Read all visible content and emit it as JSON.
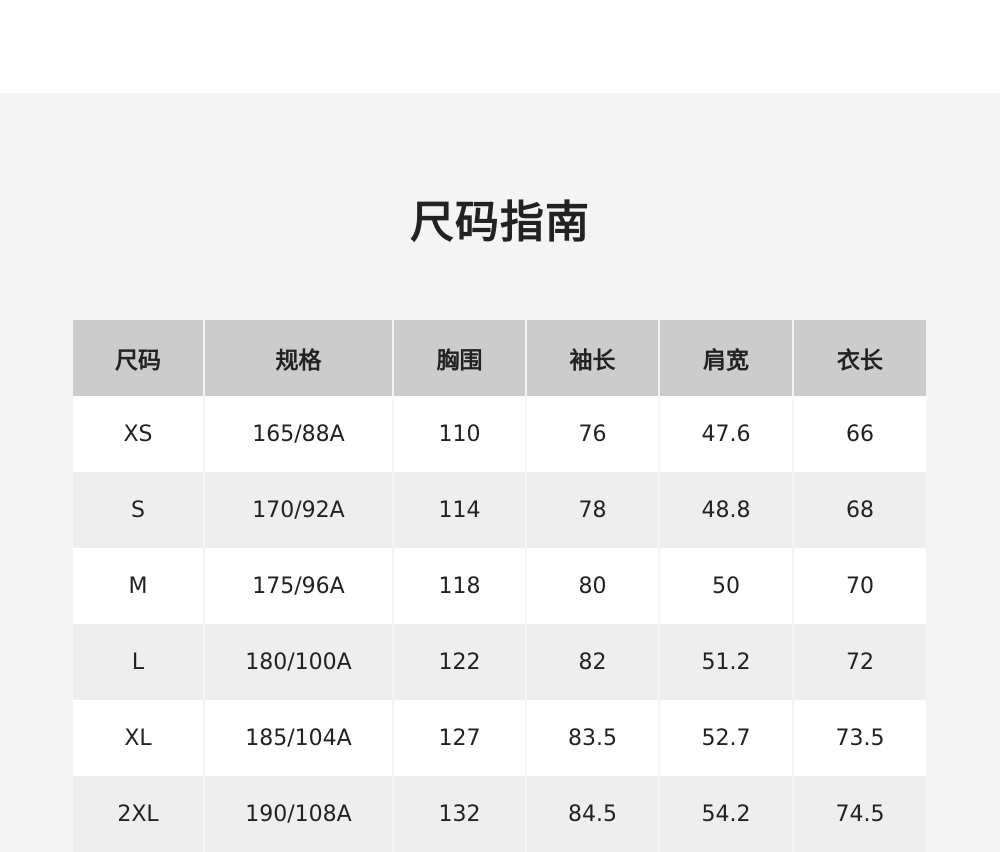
{
  "page": {
    "title": "尺码指南"
  },
  "table": {
    "headers": [
      "尺码",
      "规格",
      "胸围",
      "袖长",
      "肩宽",
      "衣长"
    ],
    "rows": [
      [
        "XS",
        "165/88A",
        "110",
        "76",
        "47.6",
        "66"
      ],
      [
        "S",
        "170/92A",
        "114",
        "78",
        "48.8",
        "68"
      ],
      [
        "M",
        "175/96A",
        "118",
        "80",
        "50",
        "70"
      ],
      [
        "L",
        "180/100A",
        "122",
        "82",
        "51.2",
        "72"
      ],
      [
        "XL",
        "185/104A",
        "127",
        "83.5",
        "52.7",
        "73.5"
      ],
      [
        "2XL",
        "190/108A",
        "132",
        "84.5",
        "54.2",
        "74.5"
      ]
    ]
  },
  "colors": {
    "header_bg": "#cccccc",
    "page_bg": "#f4f4f4",
    "row_white": "#ffffff",
    "row_gray": "#eeeeee",
    "text": "#222222"
  }
}
